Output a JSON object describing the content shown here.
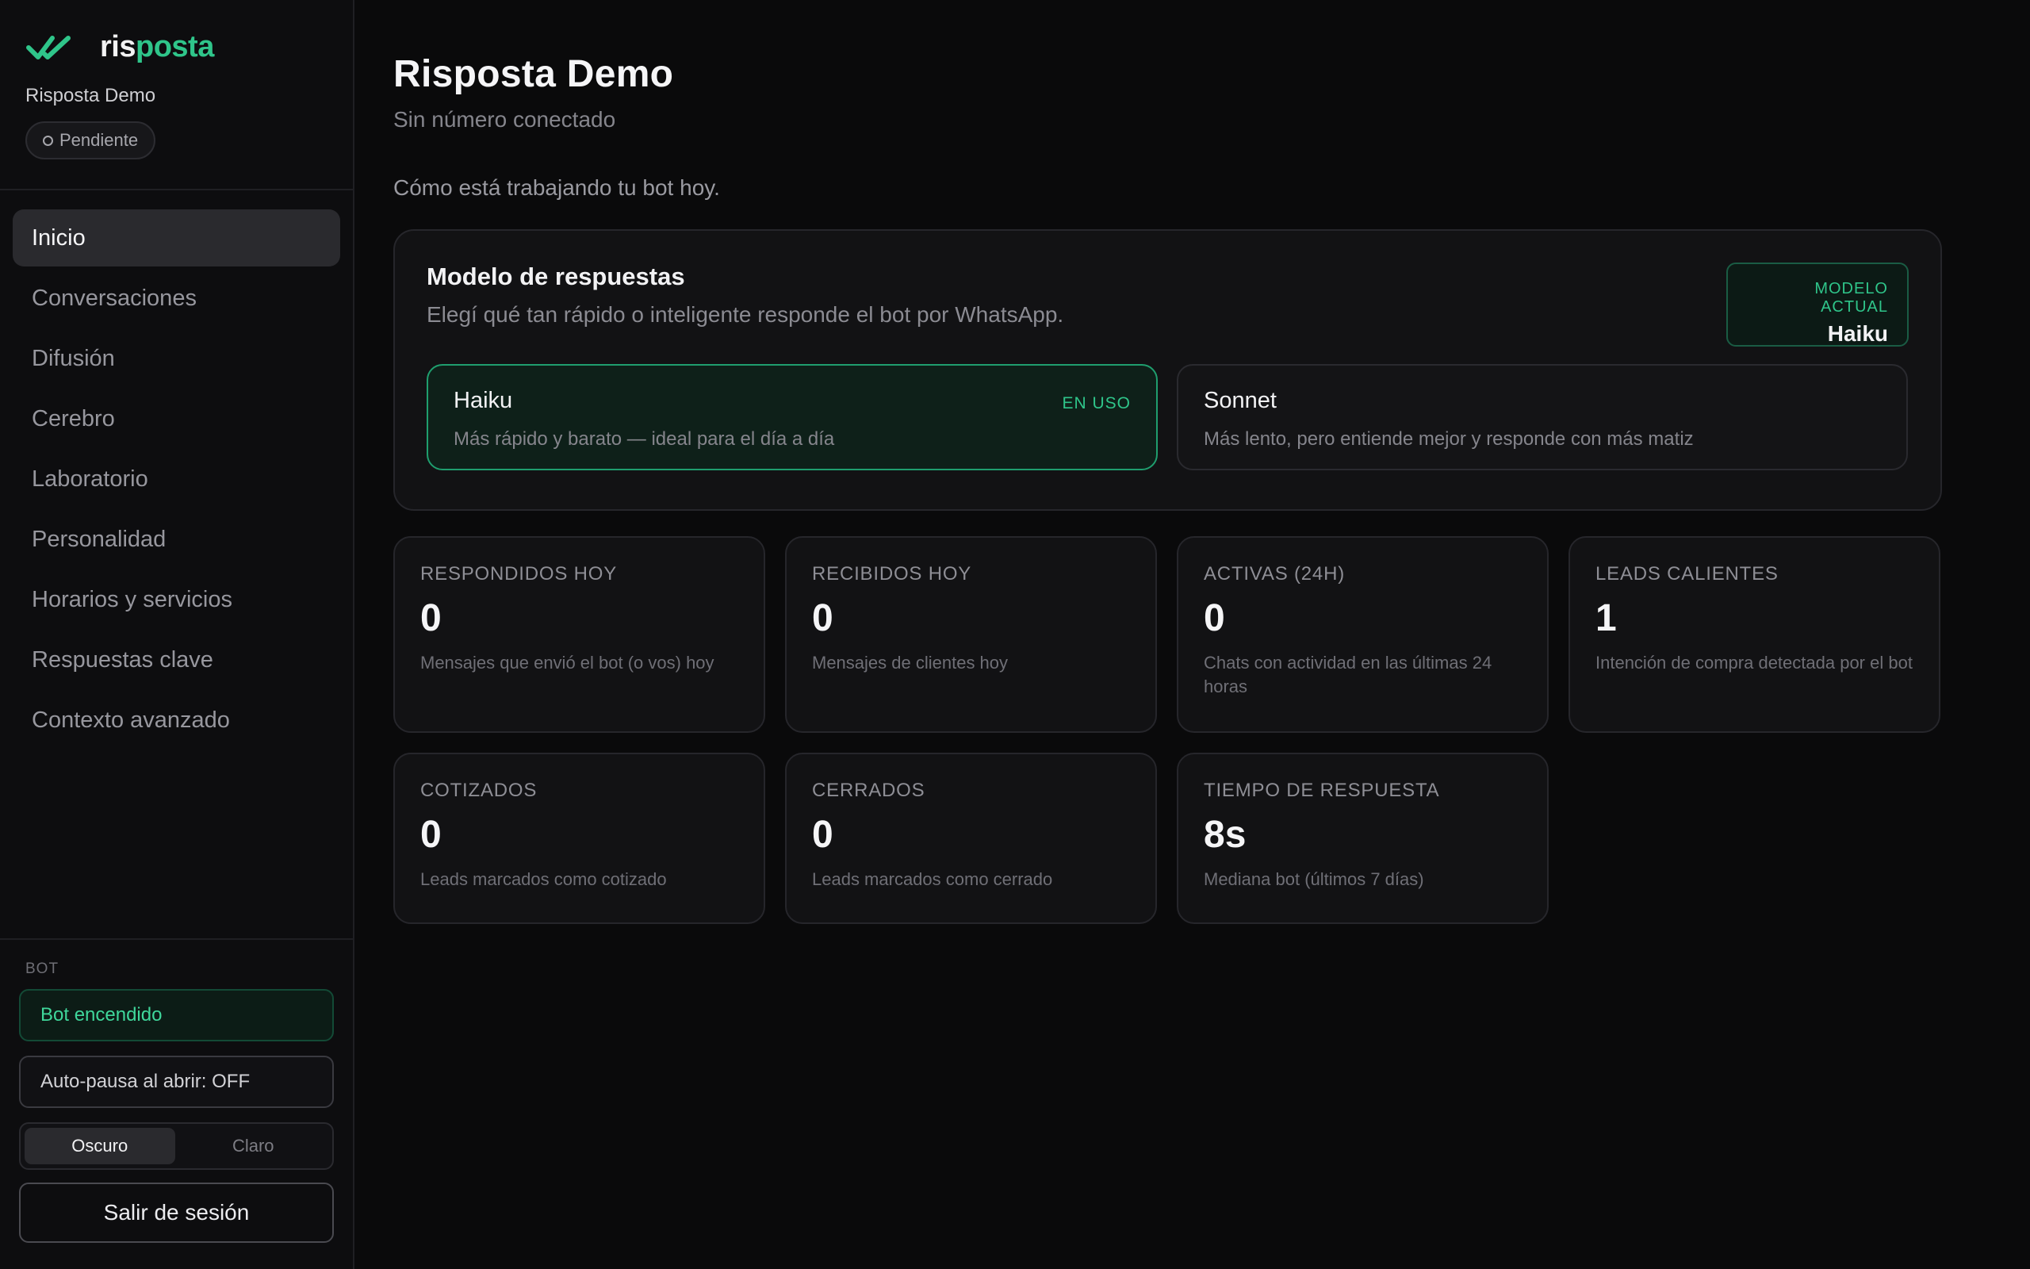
{
  "brand": {
    "name_part1": "ris",
    "name_part2": "posta",
    "accent": "#2fc58a"
  },
  "workspace": {
    "name": "Risposta Demo",
    "status": "Pendiente"
  },
  "nav": [
    {
      "label": "Inicio",
      "active": true
    },
    {
      "label": "Conversaciones"
    },
    {
      "label": "Difusión"
    },
    {
      "label": "Cerebro"
    },
    {
      "label": "Laboratorio"
    },
    {
      "label": "Personalidad"
    },
    {
      "label": "Horarios y servicios"
    },
    {
      "label": "Respuestas clave"
    },
    {
      "label": "Contexto avanzado"
    }
  ],
  "bot": {
    "section_label": "BOT",
    "status": "Bot encendido",
    "auto_pause": "Auto-pausa al abrir: OFF",
    "theme": {
      "dark": "Oscuro",
      "light": "Claro",
      "selected": "Oscuro"
    },
    "logout": "Salir de sesión"
  },
  "page": {
    "title": "Risposta Demo",
    "subtitle": "Sin número conectado",
    "lead": "Cómo está trabajando tu bot hoy."
  },
  "model_card": {
    "title": "Modelo de respuestas",
    "description": "Elegí qué tan rápido o inteligente responde el bot por WhatsApp.",
    "current_label": "MODELO ACTUAL",
    "current_value": "Haiku",
    "options": [
      {
        "name": "Haiku",
        "description": "Más rápido y barato — ideal para el día a día",
        "badge": "EN USO",
        "selected": true
      },
      {
        "name": "Sonnet",
        "description": "Más lento, pero entiende mejor y responde con más matiz",
        "selected": false
      }
    ]
  },
  "stats": [
    {
      "label": "RESPONDIDOS HOY",
      "value": "0",
      "description": "Mensajes que envió el bot (o vos) hoy"
    },
    {
      "label": "RECIBIDOS HOY",
      "value": "0",
      "description": "Mensajes de clientes hoy"
    },
    {
      "label": "ACTIVAS (24H)",
      "value": "0",
      "description": "Chats con actividad en las últimas 24 horas"
    },
    {
      "label": "LEADS CALIENTES",
      "value": "1",
      "description": "Intención de compra detectada por el bot"
    },
    {
      "label": "COTIZADOS",
      "value": "0",
      "description": "Leads marcados como cotizado"
    },
    {
      "label": "CERRADOS",
      "value": "0",
      "description": "Leads marcados como cerrado"
    },
    {
      "label": "TIEMPO DE RESPUESTA",
      "value": "8s",
      "description": "Mediana bot (últimos 7 días)"
    }
  ]
}
